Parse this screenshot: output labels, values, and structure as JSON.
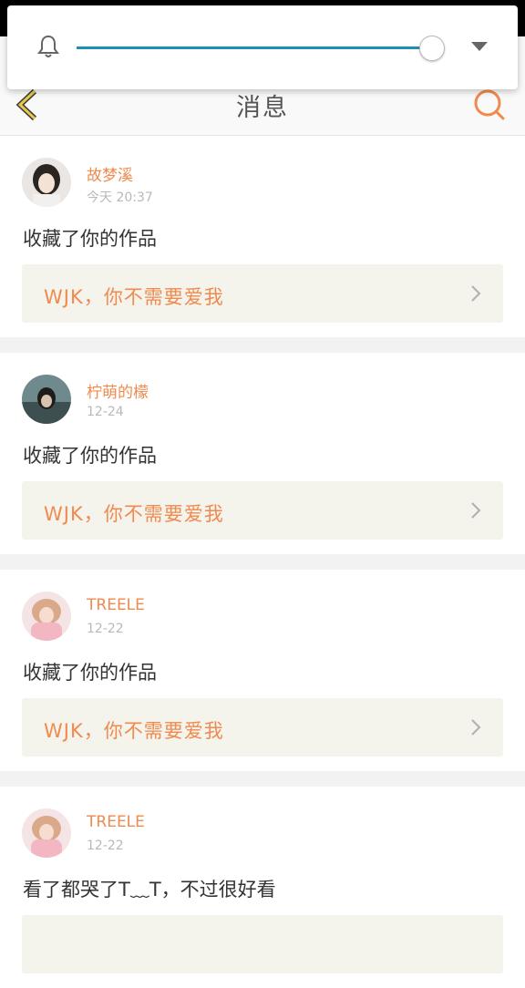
{
  "header": {
    "title": "消息",
    "back_icon": "chevron-left-icon",
    "search_icon": "search-icon",
    "accent_color": "#f08a4e"
  },
  "volume_overlay": {
    "bell_icon": "bell-icon",
    "level": 1.0,
    "dropdown_icon": "caret-down-icon"
  },
  "messages": [
    {
      "username": "故梦溪",
      "time": "今天 20:37",
      "action": "收藏了你的作品",
      "work_title": "WJK，你不需要爱我",
      "avatar": "avatar-girl-light"
    },
    {
      "username": "柠萌的檬",
      "time": "12-24",
      "action": "收藏了你的作品",
      "work_title": "WJK，你不需要爱我",
      "avatar": "avatar-girl-sea"
    },
    {
      "username": "TREELE",
      "time": "12-22",
      "action": "收藏了你的作品",
      "work_title": "WJK，你不需要爱我",
      "avatar": "avatar-girl-pink"
    },
    {
      "username": "TREELE",
      "time": "12-22",
      "action": "看了都哭了T﹏T，不过很好看",
      "work_title": "",
      "avatar": "avatar-girl-pink"
    }
  ]
}
